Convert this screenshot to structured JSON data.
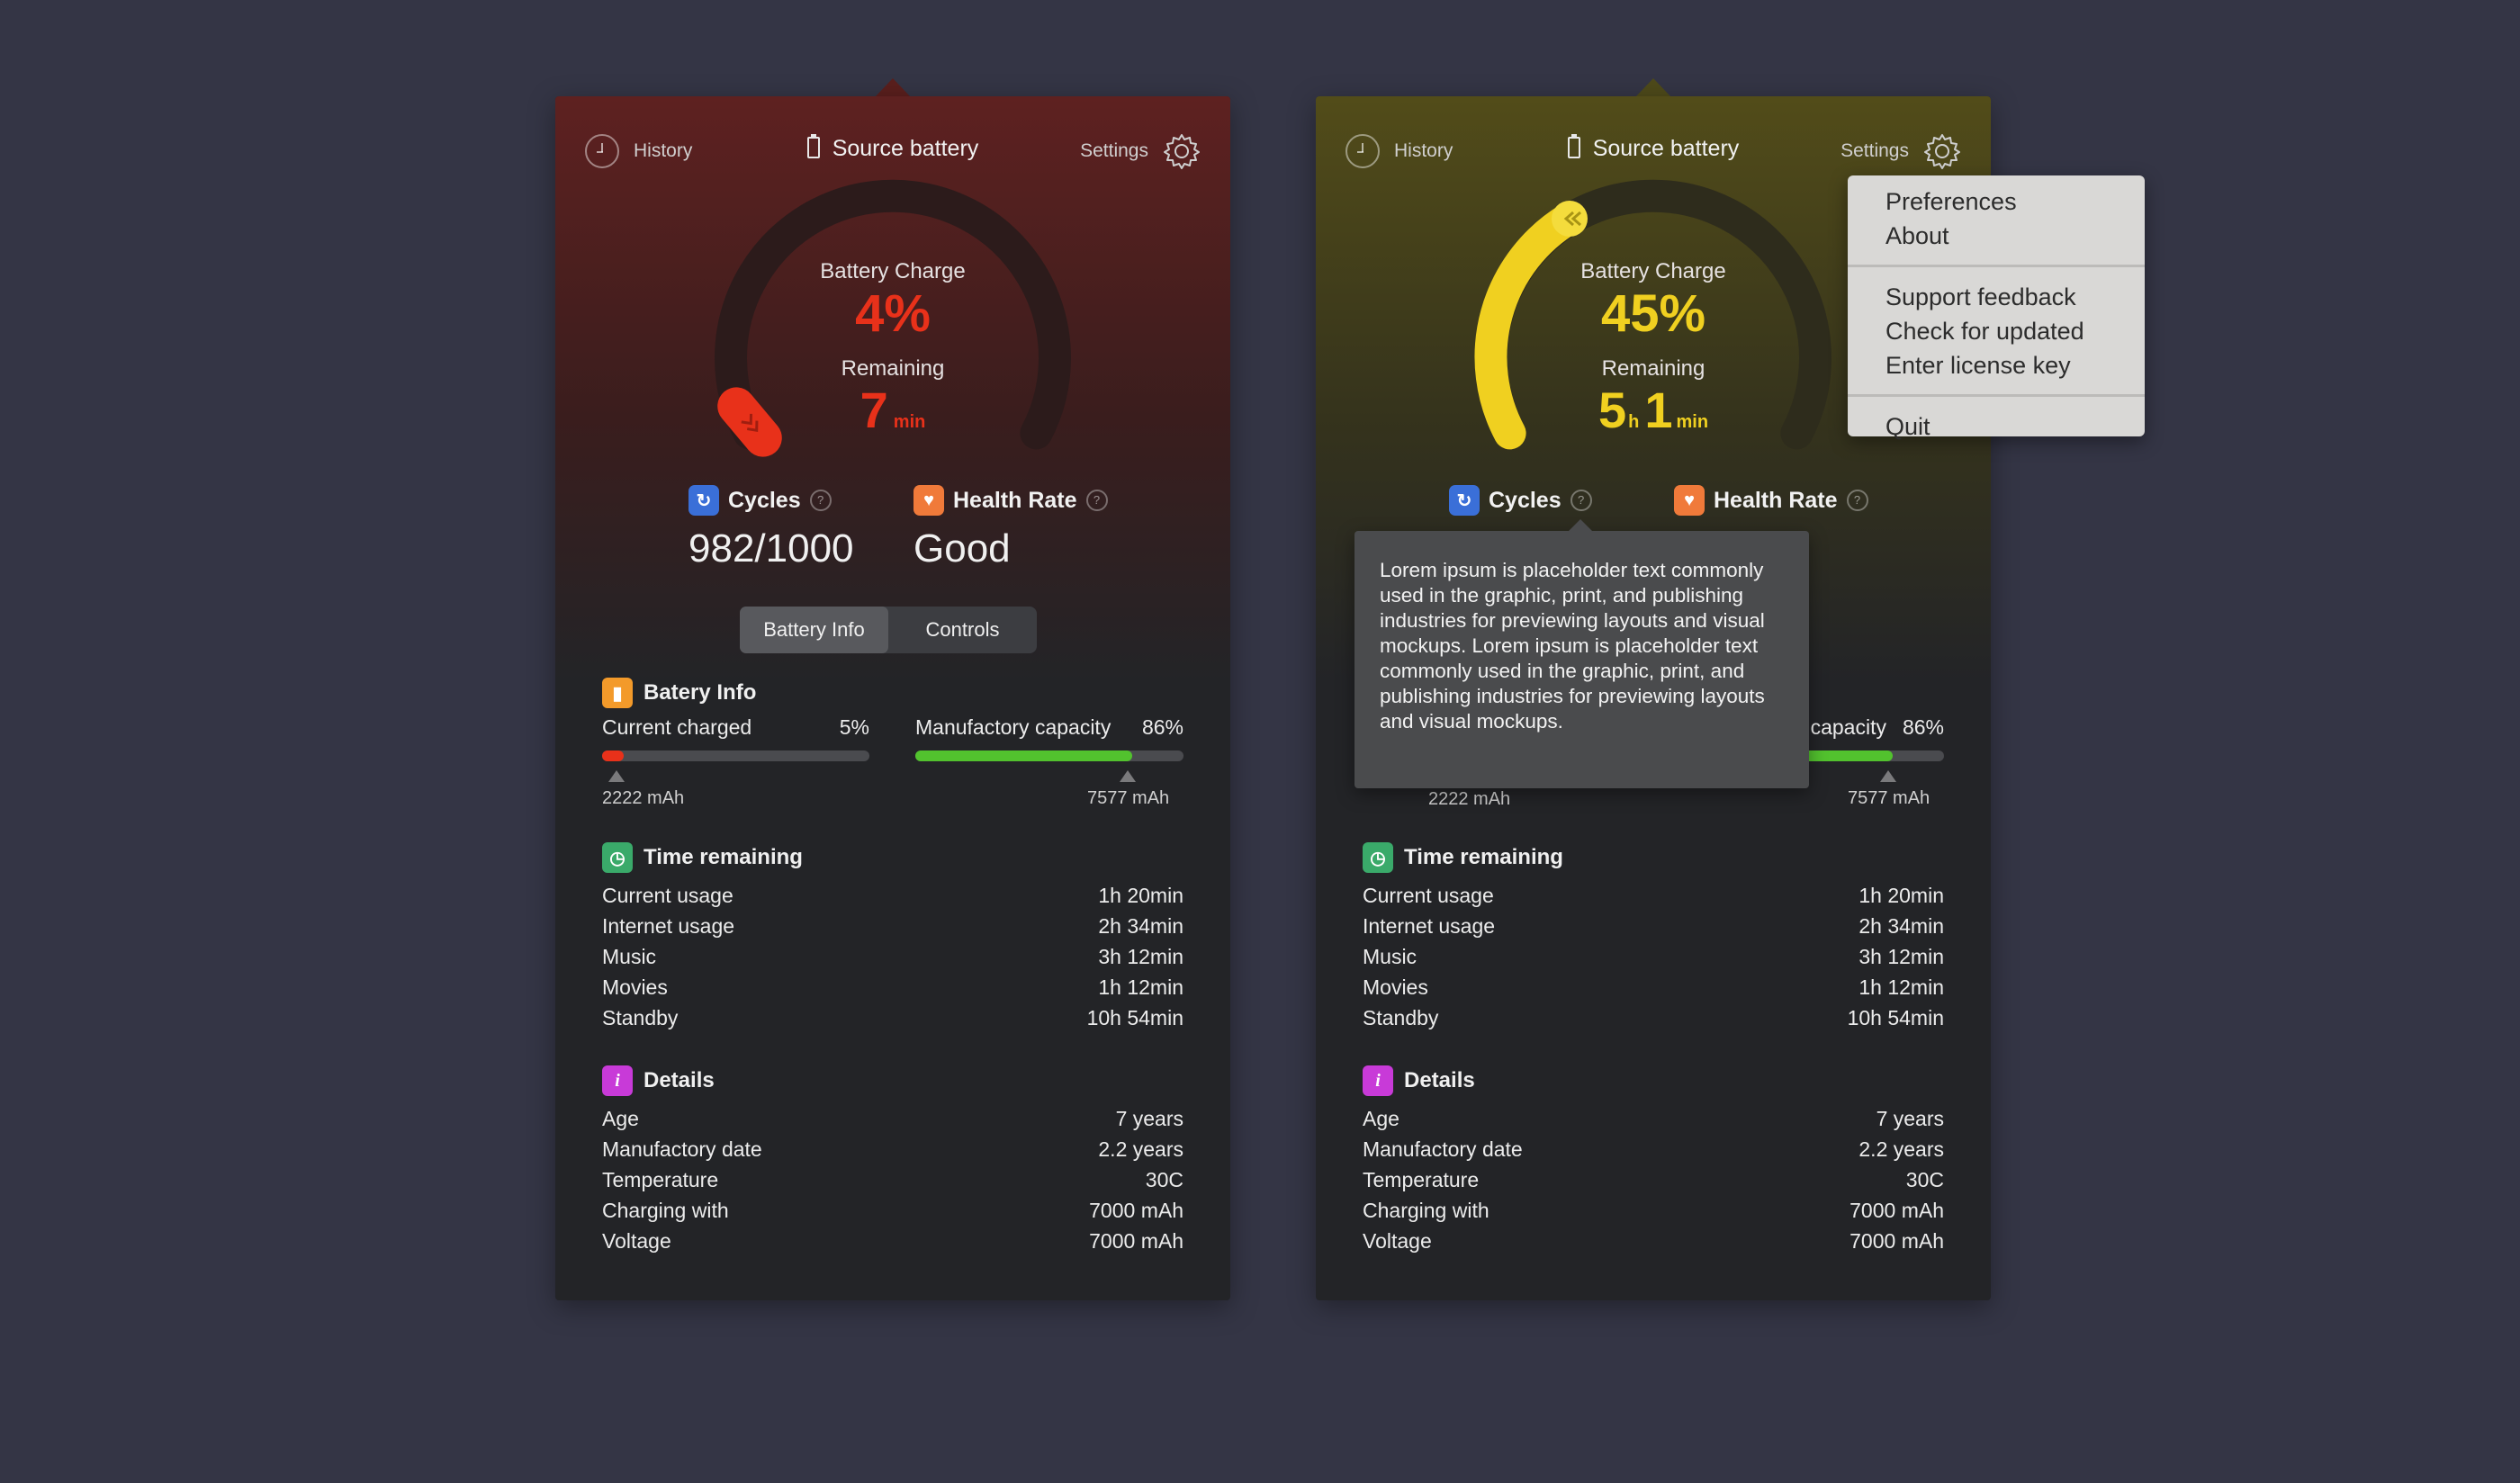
{
  "panels": [
    {
      "history_label": "History",
      "title": "Source battery",
      "settings_label": "Settings",
      "charge_label": "Battery Charge",
      "charge_value": "4%",
      "charge_fraction": 0.04,
      "remaining_label": "Remaining",
      "remaining_hours": "",
      "remaining_h_unit": "",
      "remaining_minutes": "7",
      "remaining_min_unit": "min",
      "accent": "#e8311a",
      "cycles_label": "Cycles",
      "cycles_value": "982/1000",
      "health_label": "Health Rate",
      "health_value": "Good",
      "seg_battery_info": "Battery Info",
      "seg_controls": "Controls",
      "battery_info_title": "Batery Info",
      "current_charged_label": "Current charged",
      "current_charged_value": "5%",
      "current_charged_fraction": 0.05,
      "capacity_label": "Manufactory capacity",
      "capacity_value": "86%",
      "capacity_fraction": 0.81,
      "mah_left": "2222 mAh",
      "mah_right": "7577 mAh",
      "time_title": "Time remaining",
      "time_rows": [
        {
          "label": "Current usage",
          "value": "1h 20min"
        },
        {
          "label": "Internet usage",
          "value": "2h 34min"
        },
        {
          "label": "Music",
          "value": "3h 12min"
        },
        {
          "label": "Movies",
          "value": "1h 12min"
        },
        {
          "label": "Standby",
          "value": "10h 54min"
        }
      ],
      "details_title": "Details",
      "details_rows": [
        {
          "label": "Age",
          "value": "7 years"
        },
        {
          "label": "Manufactory date",
          "value": "2.2 years"
        },
        {
          "label": "Temperature",
          "value": "30C"
        },
        {
          "label": "Charging with",
          "value": "7000 mAh"
        },
        {
          "label": "Voltage",
          "value": "7000 mAh"
        }
      ]
    },
    {
      "history_label": "History",
      "title": "Source battery",
      "settings_label": "Settings",
      "charge_label": "Battery Charge",
      "charge_value": "45%",
      "charge_fraction": 0.45,
      "remaining_label": "Remaining",
      "remaining_hours": "5",
      "remaining_h_unit": "h",
      "remaining_minutes": "1",
      "remaining_min_unit": "min",
      "accent": "#f0d020",
      "cycles_label": "Cycles",
      "health_label": "Health Rate",
      "capacity_label_partial": "capacity",
      "capacity_value": "86%",
      "capacity_fraction": 0.81,
      "mah_left": "2222 mAh",
      "mah_right": "7577 mAh",
      "time_title": "Time remaining",
      "time_rows": [
        {
          "label": "Current usage",
          "value": "1h 20min"
        },
        {
          "label": "Internet usage",
          "value": "2h 34min"
        },
        {
          "label": "Music",
          "value": "3h 12min"
        },
        {
          "label": "Movies",
          "value": "1h 12min"
        },
        {
          "label": "Standby",
          "value": "10h 54min"
        }
      ],
      "details_title": "Details",
      "details_rows": [
        {
          "label": "Age",
          "value": "7 years"
        },
        {
          "label": "Manufactory date",
          "value": "2.2 years"
        },
        {
          "label": "Temperature",
          "value": "30C"
        },
        {
          "label": "Charging with",
          "value": "7000 mAh"
        },
        {
          "label": "Voltage",
          "value": "7000 mAh"
        }
      ]
    }
  ],
  "settings_menu": [
    "Preferences",
    "About",
    "Support feedback",
    "Check for updated",
    "Enter license key",
    "Quit"
  ],
  "tooltip_text": "Lorem ipsum is placeholder text commonly used in the graphic, print, and publishing industries for previewing layouts and visual mockups. Lorem ipsum is placeholder text commonly used in the graphic, print, and publishing industries for previewing layouts and visual mockups.",
  "colors": {
    "background": "#343545",
    "panel": "#232427",
    "red_tint": "#6a2320",
    "yellow_tint": "#5a5418",
    "cycles_icon": "#3a6fd8",
    "health_icon": "#f07a3a",
    "battery_icon": "#f39a2a",
    "time_icon": "#3aaa6a",
    "details_icon": "#c83ad8",
    "green_bar": "#52c22e"
  }
}
